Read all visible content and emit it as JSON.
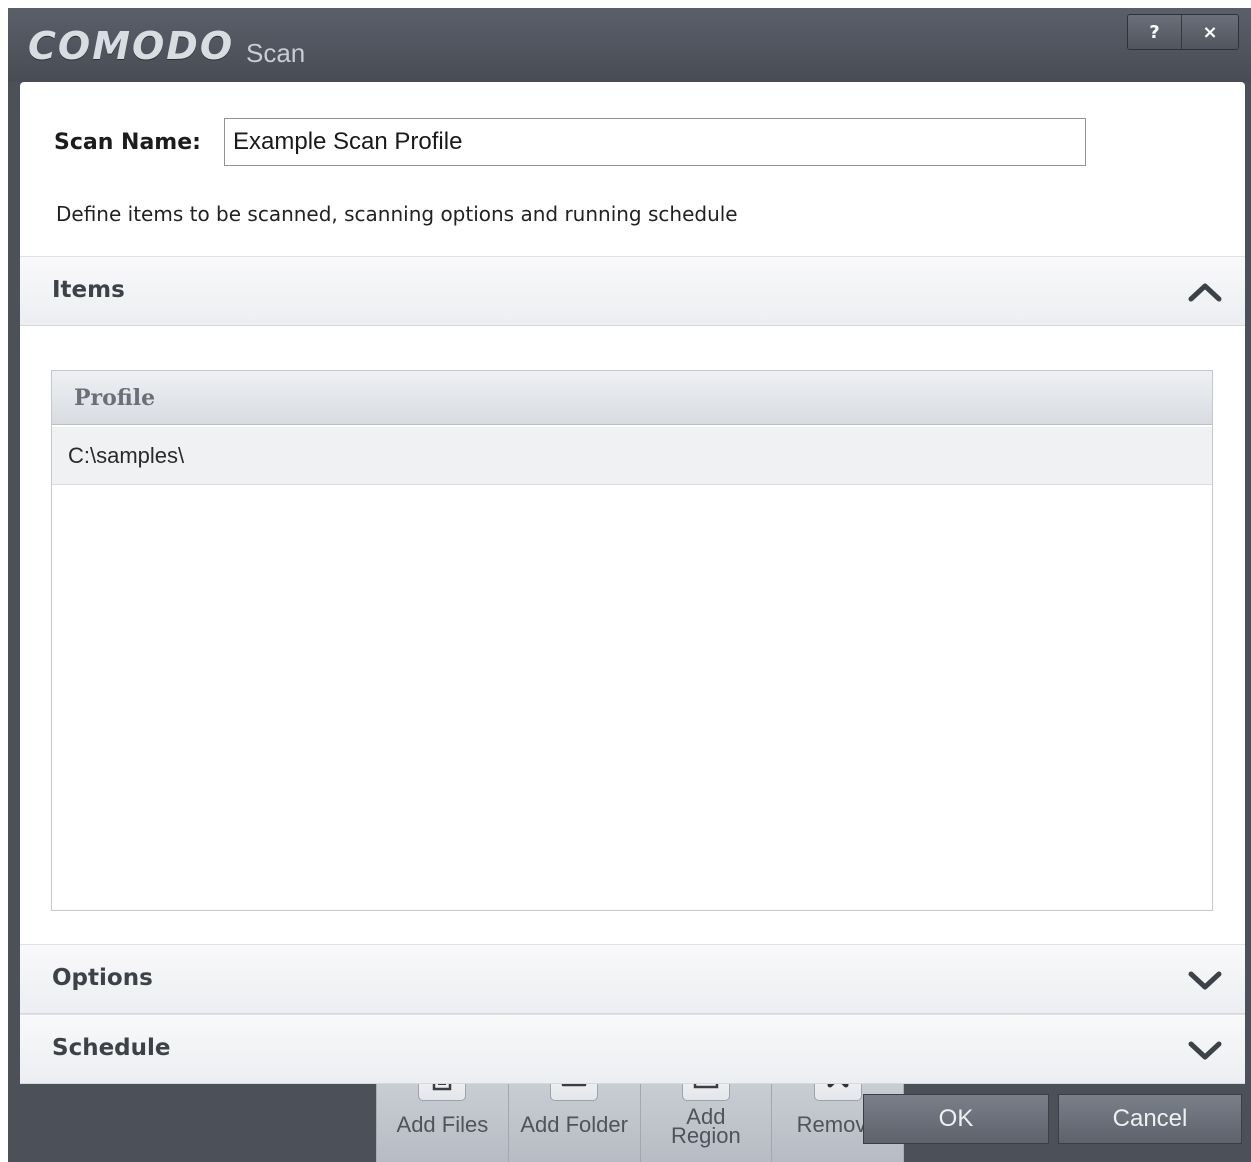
{
  "window": {
    "brand": "COMODO",
    "title": "Scan",
    "help_label": "?",
    "close_label": "×"
  },
  "form": {
    "scan_name_label": "Scan Name:",
    "scan_name_value": "Example Scan Profile",
    "description": "Define items to be scanned, scanning options and running schedule"
  },
  "sections": {
    "items": {
      "title": "Items",
      "expanded": true
    },
    "options": {
      "title": "Options",
      "expanded": false
    },
    "schedule": {
      "title": "Schedule",
      "expanded": false
    }
  },
  "items_list": {
    "column_header": "Profile",
    "rows": [
      "C:\\samples\\"
    ]
  },
  "toolbar": {
    "add_files": "Add Files",
    "add_folder": "Add Folder",
    "add_region": "Add Region",
    "remove": "Remove"
  },
  "footer": {
    "ok": "OK",
    "cancel": "Cancel"
  },
  "colors": {
    "frame": "#4b5059",
    "panel": "#ffffff",
    "section_title": "#3d4249"
  },
  "icons": {
    "add_files": "document-icon",
    "add_folder": "folder-icon",
    "add_region": "region-icon",
    "remove": "x-icon",
    "collapse": "chevron-up-icon",
    "expand": "chevron-down-icon"
  }
}
